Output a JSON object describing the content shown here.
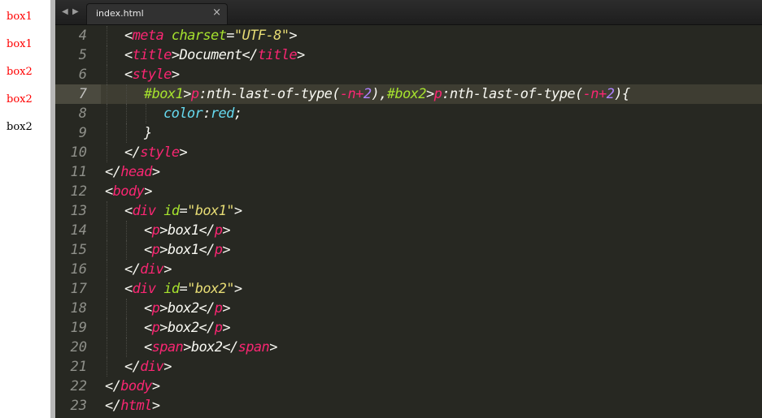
{
  "preview": {
    "items": [
      {
        "text": "box1",
        "color": "#ff0000"
      },
      {
        "text": "box1",
        "color": "#ff0000"
      },
      {
        "text": "box2",
        "color": "#ff0000"
      },
      {
        "text": "box2",
        "color": "#ff0000"
      },
      {
        "text": "box2",
        "color": "#000000"
      }
    ]
  },
  "tabbar": {
    "back_icon": "◀",
    "forward_icon": "▶",
    "tab_title": "index.html",
    "close_icon": "×"
  },
  "colors": {
    "background": "#272822",
    "tag": "#f92672",
    "attr": "#a6e22e",
    "string": "#e6db74",
    "property": "#66d9ef",
    "number": "#ae81ff",
    "text": "#f8f8f2",
    "line_number": "#8f908a"
  },
  "editor": {
    "active_line": 7,
    "lines": [
      {
        "num": "4",
        "indent": 1,
        "tokens": [
          [
            "p",
            "<"
          ],
          [
            "t",
            "meta"
          ],
          [
            "p",
            " "
          ],
          [
            "a",
            "charset"
          ],
          [
            "p",
            "="
          ],
          [
            "s",
            "\"UTF-8\""
          ],
          [
            "p",
            ">"
          ]
        ]
      },
      {
        "num": "5",
        "indent": 1,
        "tokens": [
          [
            "p",
            "<"
          ],
          [
            "t",
            "title"
          ],
          [
            "p",
            ">Document</"
          ],
          [
            "t",
            "title"
          ],
          [
            "p",
            ">"
          ]
        ]
      },
      {
        "num": "6",
        "indent": 1,
        "tokens": [
          [
            "p",
            "<"
          ],
          [
            "t",
            "style"
          ],
          [
            "p",
            ">"
          ]
        ]
      },
      {
        "num": "7",
        "indent": 2,
        "tokens": [
          [
            "a",
            "#box1"
          ],
          [
            "p",
            ">"
          ],
          [
            "t",
            "p"
          ],
          [
            "p",
            ":nth-last-of-type("
          ],
          [
            "t",
            "-"
          ],
          [
            "t",
            "n"
          ],
          [
            "t",
            "+"
          ],
          [
            "n",
            "2"
          ],
          [
            "p",
            "),"
          ],
          [
            "a",
            "#box2"
          ],
          [
            "p",
            ">"
          ],
          [
            "t",
            "p"
          ],
          [
            "p",
            ":nth-last-of-type("
          ],
          [
            "t",
            "-"
          ],
          [
            "t",
            "n"
          ],
          [
            "t",
            "+"
          ],
          [
            "n",
            "2"
          ],
          [
            "p",
            "){"
          ]
        ]
      },
      {
        "num": "8",
        "indent": 3,
        "tokens": [
          [
            "k",
            "color"
          ],
          [
            "p",
            ":"
          ],
          [
            "k",
            "red"
          ],
          [
            "p",
            ";"
          ]
        ]
      },
      {
        "num": "9",
        "indent": 2,
        "tokens": [
          [
            "p",
            "}"
          ]
        ]
      },
      {
        "num": "10",
        "indent": 1,
        "tokens": [
          [
            "p",
            "</"
          ],
          [
            "t",
            "style"
          ],
          [
            "p",
            ">"
          ]
        ]
      },
      {
        "num": "11",
        "indent": 0,
        "tokens": [
          [
            "p",
            "</"
          ],
          [
            "t",
            "head"
          ],
          [
            "p",
            ">"
          ]
        ]
      },
      {
        "num": "12",
        "indent": 0,
        "tokens": [
          [
            "p",
            "<"
          ],
          [
            "t",
            "body"
          ],
          [
            "p",
            ">"
          ]
        ]
      },
      {
        "num": "13",
        "indent": 1,
        "tokens": [
          [
            "p",
            "<"
          ],
          [
            "t",
            "div"
          ],
          [
            "p",
            " "
          ],
          [
            "a",
            "id"
          ],
          [
            "p",
            "="
          ],
          [
            "s",
            "\"box1\""
          ],
          [
            "p",
            ">"
          ]
        ]
      },
      {
        "num": "14",
        "indent": 2,
        "tokens": [
          [
            "p",
            "<"
          ],
          [
            "t",
            "p"
          ],
          [
            "p",
            ">box1</"
          ],
          [
            "t",
            "p"
          ],
          [
            "p",
            ">"
          ]
        ]
      },
      {
        "num": "15",
        "indent": 2,
        "tokens": [
          [
            "p",
            "<"
          ],
          [
            "t",
            "p"
          ],
          [
            "p",
            ">box1</"
          ],
          [
            "t",
            "p"
          ],
          [
            "p",
            ">"
          ]
        ]
      },
      {
        "num": "16",
        "indent": 1,
        "tokens": [
          [
            "p",
            "</"
          ],
          [
            "t",
            "div"
          ],
          [
            "p",
            ">"
          ]
        ]
      },
      {
        "num": "17",
        "indent": 1,
        "tokens": [
          [
            "p",
            "<"
          ],
          [
            "t",
            "div"
          ],
          [
            "p",
            " "
          ],
          [
            "a",
            "id"
          ],
          [
            "p",
            "="
          ],
          [
            "s",
            "\"box2\""
          ],
          [
            "p",
            ">"
          ]
        ]
      },
      {
        "num": "18",
        "indent": 2,
        "tokens": [
          [
            "p",
            "<"
          ],
          [
            "t",
            "p"
          ],
          [
            "p",
            ">box2</"
          ],
          [
            "t",
            "p"
          ],
          [
            "p",
            ">"
          ]
        ]
      },
      {
        "num": "19",
        "indent": 2,
        "tokens": [
          [
            "p",
            "<"
          ],
          [
            "t",
            "p"
          ],
          [
            "p",
            ">box2</"
          ],
          [
            "t",
            "p"
          ],
          [
            "p",
            ">"
          ]
        ]
      },
      {
        "num": "20",
        "indent": 2,
        "tokens": [
          [
            "p",
            "<"
          ],
          [
            "t",
            "span"
          ],
          [
            "p",
            ">box2</"
          ],
          [
            "t",
            "span"
          ],
          [
            "p",
            ">"
          ]
        ]
      },
      {
        "num": "21",
        "indent": 1,
        "tokens": [
          [
            "p",
            "</"
          ],
          [
            "t",
            "div"
          ],
          [
            "p",
            ">"
          ]
        ]
      },
      {
        "num": "22",
        "indent": 0,
        "tokens": [
          [
            "p",
            "</"
          ],
          [
            "t",
            "body"
          ],
          [
            "p",
            ">"
          ]
        ]
      },
      {
        "num": "23",
        "indent": 0,
        "tokens": [
          [
            "p",
            "</"
          ],
          [
            "t",
            "html"
          ],
          [
            "p",
            ">"
          ]
        ]
      }
    ]
  }
}
